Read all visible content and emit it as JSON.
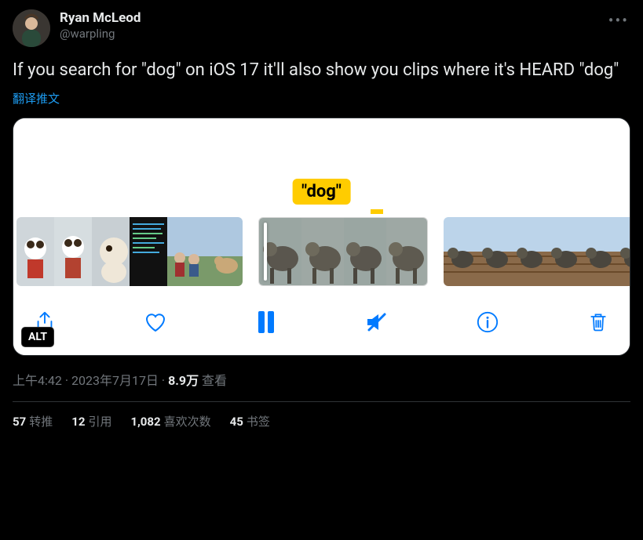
{
  "user": {
    "display_name": "Ryan McLeod",
    "handle": "@warpling"
  },
  "tweet_text": "If you search for \"dog\" on iOS 17 it'll also show you clips where it's HEARD \"dog\"",
  "translate_label": "翻译推文",
  "media": {
    "search_tag": "\"dog\"",
    "alt_badge": "ALT"
  },
  "meta": {
    "time": "上午4:42",
    "sep1": " · ",
    "date": "2023年7月17日",
    "sep2": " · ",
    "views_count": "8.9万",
    "views_label": " 查看"
  },
  "stats": {
    "retweets_count": "57",
    "retweets_label": "转推",
    "quotes_count": "12",
    "quotes_label": "引用",
    "likes_count": "1,082",
    "likes_label": "喜欢次数",
    "bookmarks_count": "45",
    "bookmarks_label": "书签"
  }
}
